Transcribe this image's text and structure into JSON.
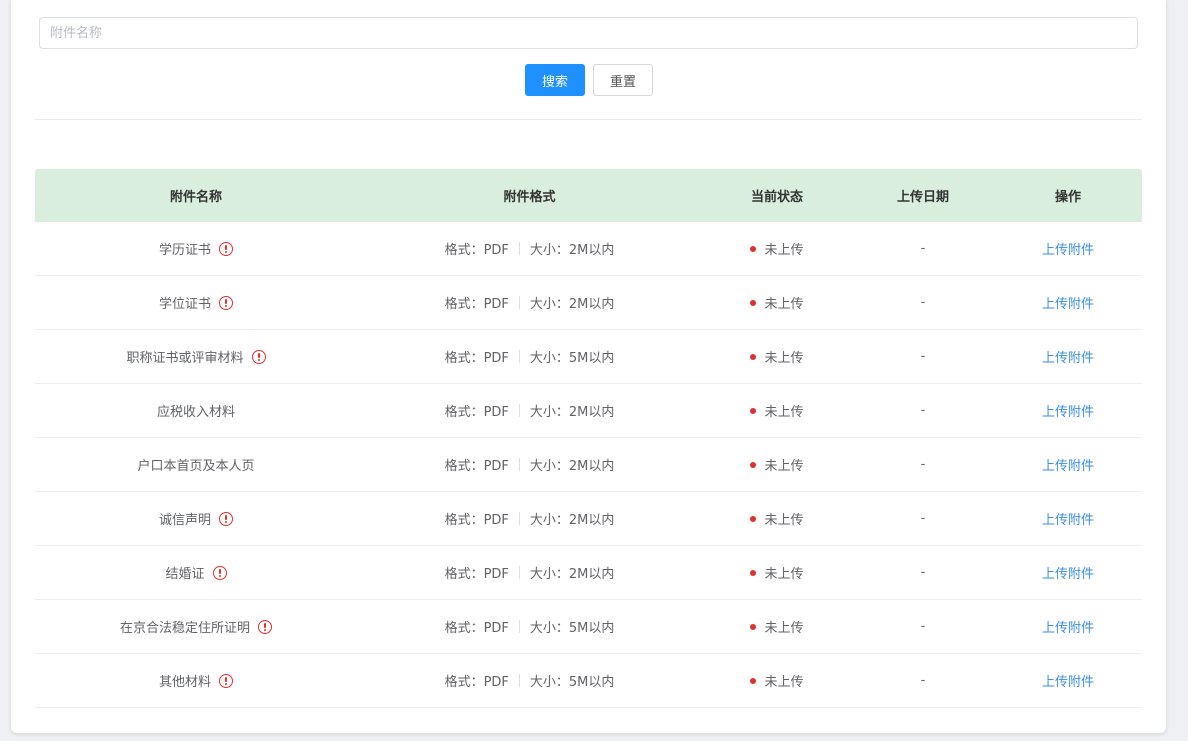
{
  "search": {
    "placeholder": "附件名称",
    "value": ""
  },
  "buttons": {
    "search_label": "搜索",
    "reset_label": "重置"
  },
  "table": {
    "headers": [
      "附件名称",
      "附件格式",
      "当前状态",
      "上传日期",
      "操作"
    ],
    "rows": [
      {
        "name": "学历证书",
        "required": true,
        "format": "格式：PDF",
        "size": "大小：2M以内",
        "status": "未上传",
        "date": "-",
        "action": "上传附件"
      },
      {
        "name": "学位证书",
        "required": true,
        "format": "格式：PDF",
        "size": "大小：2M以内",
        "status": "未上传",
        "date": "-",
        "action": "上传附件"
      },
      {
        "name": "职称证书或评审材料",
        "required": true,
        "format": "格式：PDF",
        "size": "大小：5M以内",
        "status": "未上传",
        "date": "-",
        "action": "上传附件"
      },
      {
        "name": "应税收入材料",
        "required": false,
        "format": "格式：PDF",
        "size": "大小：2M以内",
        "status": "未上传",
        "date": "-",
        "action": "上传附件"
      },
      {
        "name": "户口本首页及本人页",
        "required": false,
        "format": "格式：PDF",
        "size": "大小：2M以内",
        "status": "未上传",
        "date": "-",
        "action": "上传附件"
      },
      {
        "name": "诚信声明",
        "required": true,
        "format": "格式：PDF",
        "size": "大小：2M以内",
        "status": "未上传",
        "date": "-",
        "action": "上传附件"
      },
      {
        "name": "结婚证",
        "required": true,
        "format": "格式：PDF",
        "size": "大小：2M以内",
        "status": "未上传",
        "date": "-",
        "action": "上传附件"
      },
      {
        "name": "在京合法稳定住所证明",
        "required": true,
        "format": "格式：PDF",
        "size": "大小：5M以内",
        "status": "未上传",
        "date": "-",
        "action": "上传附件"
      },
      {
        "name": "其他材料",
        "required": true,
        "format": "格式：PDF",
        "size": "大小：5M以内",
        "status": "未上传",
        "date": "-",
        "action": "上传附件"
      }
    ]
  },
  "colors": {
    "primary": "#1e90ff",
    "header_bg": "#d9eedd",
    "status_dot": "#e0302f",
    "link": "#3a8ee6"
  },
  "icons": {
    "required": "exclamation-circle-icon"
  }
}
